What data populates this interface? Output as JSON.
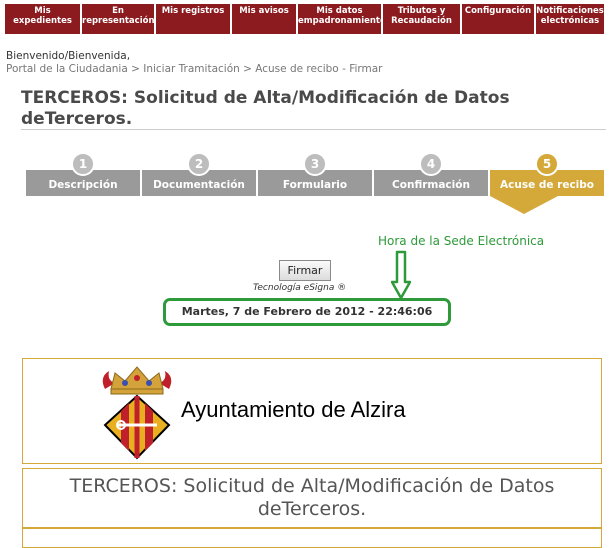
{
  "nav": [
    {
      "line1": "Mis",
      "line2": "expedientes"
    },
    {
      "line1": "En",
      "line2": "representación"
    },
    {
      "line1": "Mis registros",
      "line2": ""
    },
    {
      "line1": "Mis avisos",
      "line2": ""
    },
    {
      "line1": "Mis datos",
      "line2": "empadronamiento"
    },
    {
      "line1": "Tributos y",
      "line2": "Recaudación"
    },
    {
      "line1": "Configuración",
      "line2": ""
    },
    {
      "line1": "Notificaciones",
      "line2": "electrónicas"
    }
  ],
  "welcome": "Bienvenido/Bienvenida,",
  "breadcrumb": "Portal de la Ciudadania > Iniciar Tramitación > Acuse de recibo - Firmar",
  "page_title": "TERCEROS: Solicitud de Alta/Modificación de Datos deTerceros.",
  "steps": [
    {
      "num": "1",
      "label": "Descripción",
      "active": false
    },
    {
      "num": "2",
      "label": "Documentación",
      "active": false
    },
    {
      "num": "3",
      "label": "Formulario",
      "active": false
    },
    {
      "num": "4",
      "label": "Confirmación",
      "active": false
    },
    {
      "num": "5",
      "label": "Acuse de recibo",
      "active": true
    }
  ],
  "clock_label": "Hora de la Sede Electrónica",
  "sign_button": "Firmar",
  "esigna": "Tecnología eSigna ®",
  "datetime": "Martes, 7 de Febrero de 2012 - 22:46:06",
  "logo_text": "Ayuntamiento de Alzira",
  "info_title": "TERCEROS: Solicitud de Alta/Modificación de Datos deTerceros.",
  "colors": {
    "nav_bg": "#8c1b1f",
    "step_bg": "#9a9a9a",
    "step_active": "#d4a93a",
    "highlight": "#2e9a3a"
  }
}
